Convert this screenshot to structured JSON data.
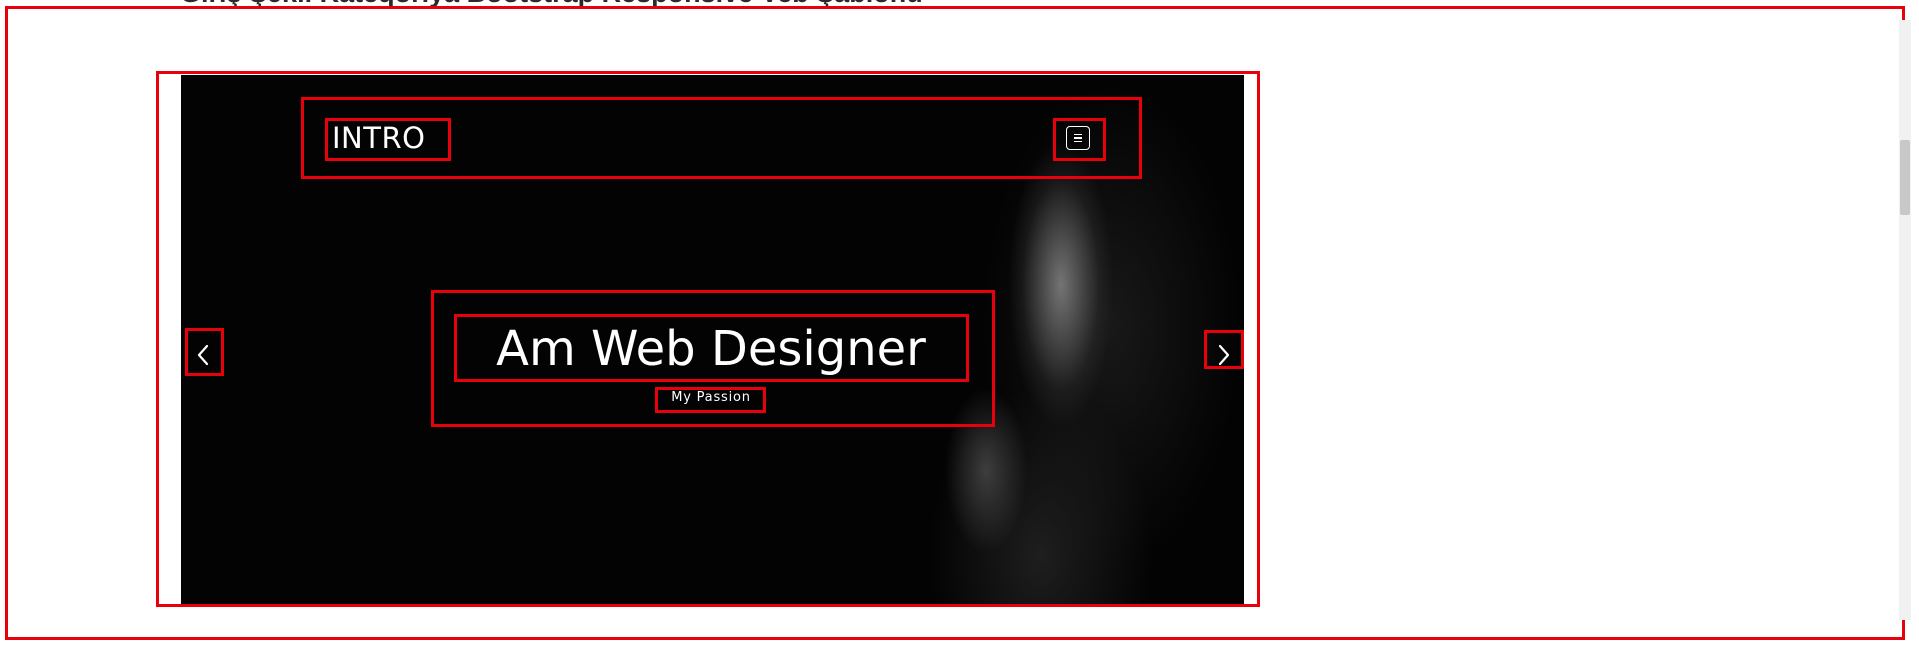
{
  "page": {
    "heading": "Giriş Şəkil Kateqoriya Bootstrap Responsive Veb Şablonu"
  },
  "preview": {
    "nav": {
      "brand": "INTRO",
      "menu_icon": "hamburger-icon"
    },
    "hero": {
      "title": "Am Web Designer",
      "tagline": "My Passion"
    },
    "carousel": {
      "prev_icon": "chevron-left-icon",
      "next_icon": "chevron-right-icon"
    }
  },
  "colors": {
    "highlight": "#e8000b",
    "hero_background": "#030303",
    "text": "#ffffff"
  }
}
